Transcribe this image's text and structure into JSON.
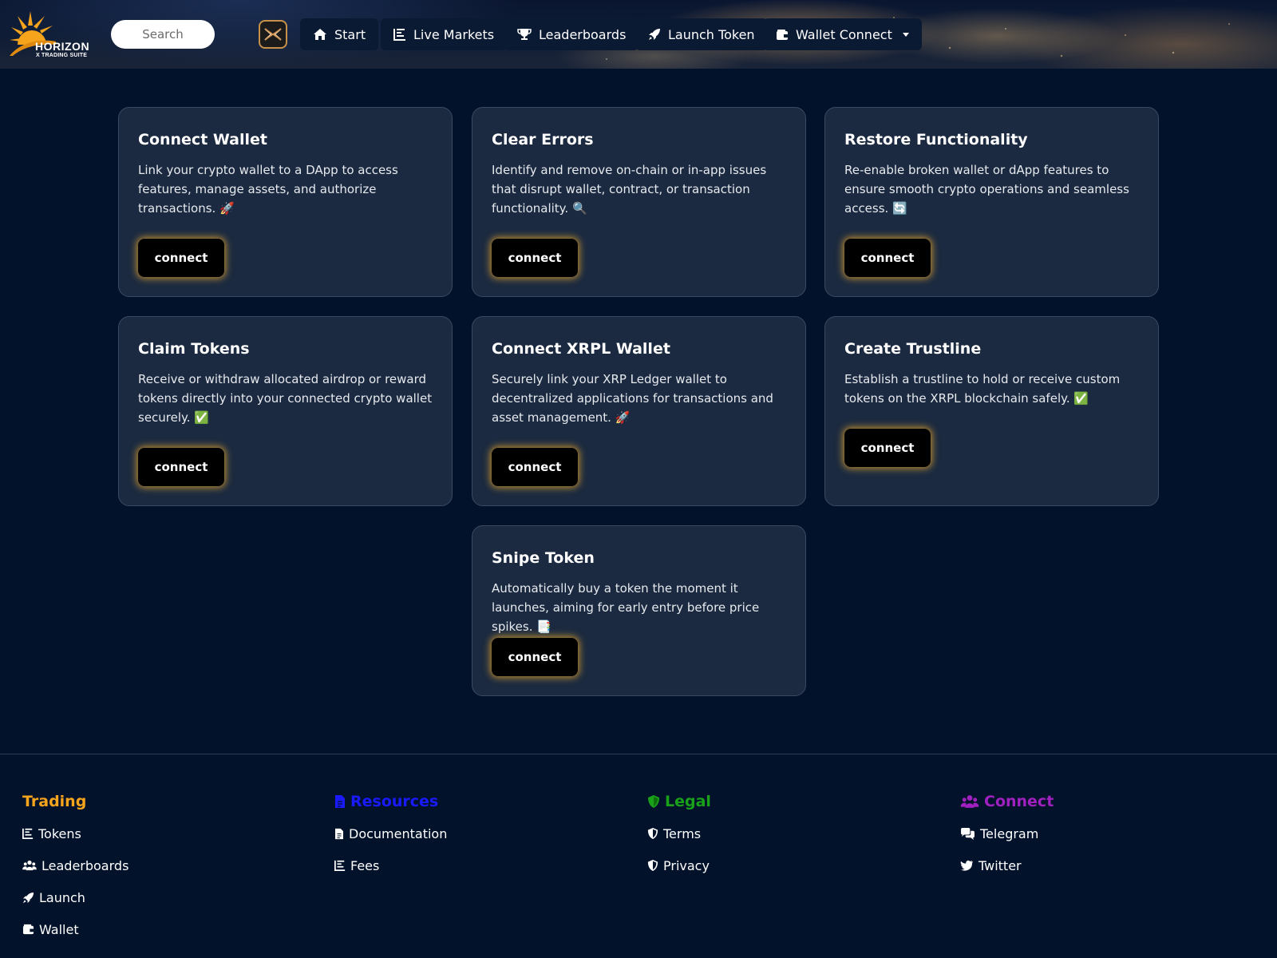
{
  "header": {
    "logo": {
      "word": "HORIZON",
      "sub": "X TRADING SUITE"
    },
    "search": {
      "placeholder": "Search"
    },
    "nav": [
      {
        "label": "Start",
        "icon": "home-icon"
      },
      {
        "label": "Live Markets",
        "icon": "chart-icon"
      },
      {
        "label": "Leaderboards",
        "icon": "trophy-icon"
      },
      {
        "label": "Launch Token",
        "icon": "rocket-icon"
      },
      {
        "label": "Wallet Connect",
        "icon": "wallet-icon"
      }
    ]
  },
  "cards": [
    {
      "title": "Connect Wallet",
      "text": "Link your crypto wallet to a DApp to access features, manage assets, and authorize transactions. 🚀",
      "button": "connect"
    },
    {
      "title": "Clear Errors",
      "text": "Identify and remove on-chain or in-app issues that disrupt wallet, contract, or transaction functionality. 🔍",
      "button": "connect"
    },
    {
      "title": "Restore Functionality",
      "text": "Re-enable broken wallet or dApp features to ensure smooth crypto operations and seamless access. 🔄",
      "button": "connect"
    },
    {
      "title": "Claim Tokens",
      "text": "Receive or withdraw allocated airdrop or reward tokens directly into your connected crypto wallet securely. ✅",
      "button": "connect"
    },
    {
      "title": "Connect XRPL Wallet",
      "text": "Securely link your XRP Ledger wallet to decentralized applications for transactions and asset management. 🚀",
      "button": "connect"
    },
    {
      "title": "Create Trustline",
      "text": "Establish a trustline to hold or receive custom tokens on the XRPL blockchain safely. ✅",
      "button": "connect"
    },
    {
      "title": "Snipe Token",
      "text": "Automatically buy a token the moment it launches, aiming for early entry before price spikes. 📑",
      "button": "connect"
    }
  ],
  "footer": {
    "trading": {
      "title": "Trading",
      "color": "#f7a41d",
      "links": [
        {
          "label": "Tokens",
          "icon": "chart-icon"
        },
        {
          "label": "Leaderboards",
          "icon": "users-icon"
        },
        {
          "label": "Launch",
          "icon": "rocket-icon"
        },
        {
          "label": "Wallet",
          "icon": "wallet-icon"
        }
      ]
    },
    "resources": {
      "title": "Resources",
      "color": "#1a1aff",
      "links": [
        {
          "label": "Documentation",
          "icon": "file-icon"
        },
        {
          "label": "Fees",
          "icon": "chart-icon"
        }
      ]
    },
    "legal": {
      "title": "Legal",
      "color": "#1aa11a",
      "links": [
        {
          "label": "Terms",
          "icon": "shield-icon"
        },
        {
          "label": "Privacy",
          "icon": "shield-icon"
        }
      ]
    },
    "connect": {
      "title": "Connect",
      "color": "#a020c0",
      "links": [
        {
          "label": "Telegram",
          "icon": "chat-icon"
        },
        {
          "label": "Twitter",
          "icon": "twitter-icon"
        }
      ]
    }
  }
}
